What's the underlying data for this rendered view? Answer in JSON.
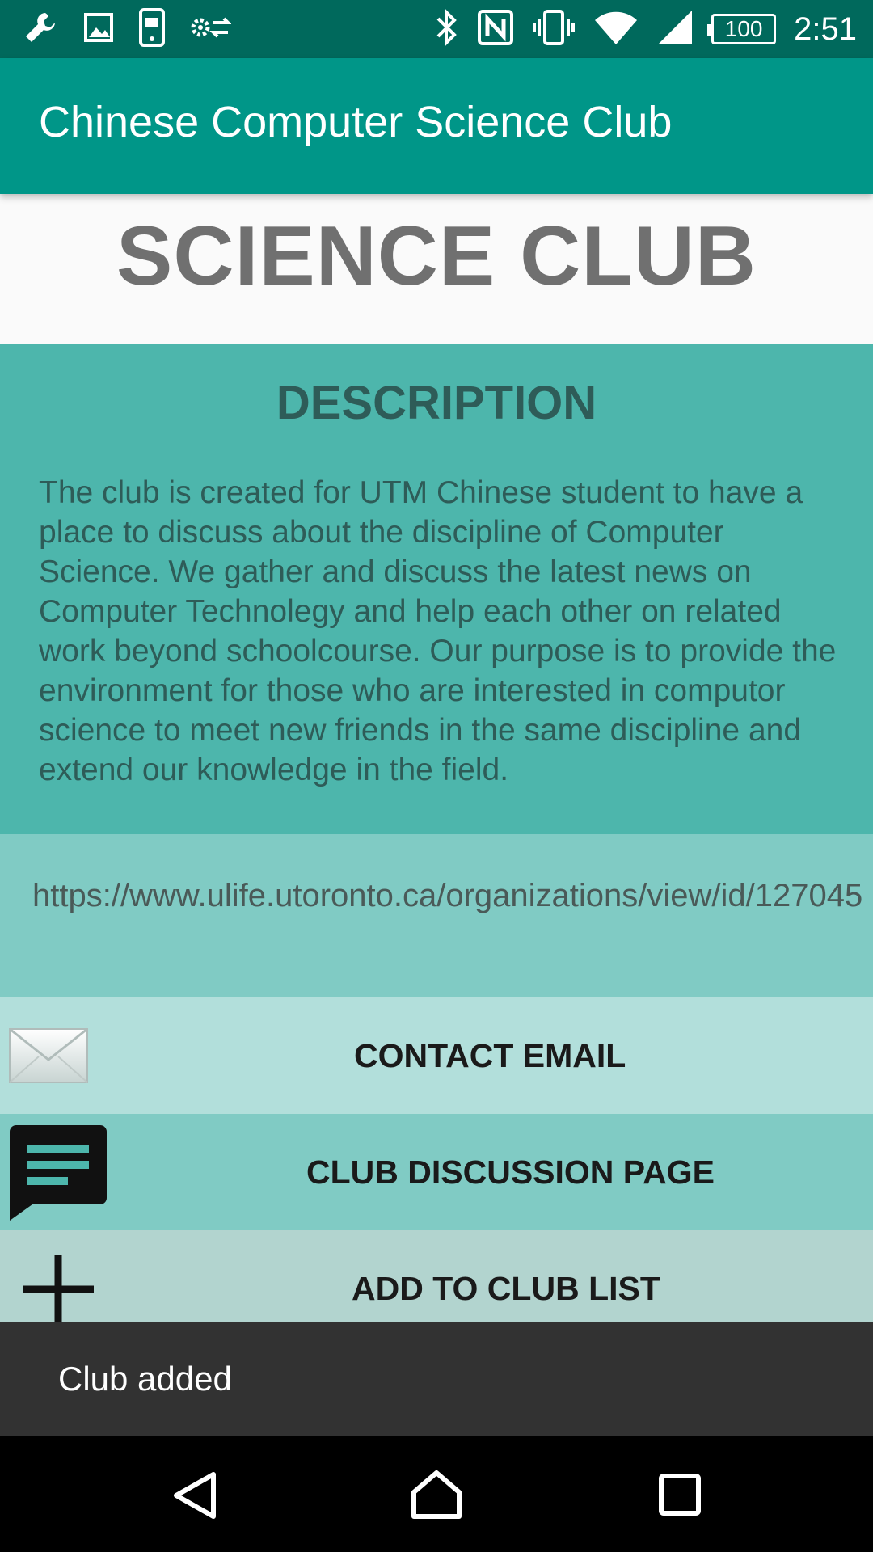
{
  "status_bar": {
    "left_icons": [
      "wrench-icon",
      "image-icon",
      "phone-icon",
      "settings-sync-icon"
    ],
    "right_icons": [
      "bluetooth-icon",
      "nfc-icon",
      "vibrate-icon",
      "wifi-icon",
      "signal-icon"
    ],
    "battery": "100",
    "time": "2:51"
  },
  "app_bar": {
    "title": "Chinese Computer Science Club"
  },
  "header": {
    "club_name": "SCIENCE CLUB"
  },
  "description": {
    "heading": "DESCRIPTION",
    "text": "The club is created for UTM Chinese student to have a place to discuss about the discipline of Computer Science. We gather and discuss the latest news on Computer Technolegy and help each other on related work beyond schoolcourse. Our purpose is to provide the environment for those who are interested in computor science to meet new friends in the same discipline and extend our knowledge in the field."
  },
  "link": {
    "url": "https://www.ulife.utoronto.ca/organizations/view/id/127045"
  },
  "actions": {
    "email_label": "CONTACT EMAIL",
    "discussion_label": "CLUB DISCUSSION PAGE",
    "add_label": "ADD TO CLUB LIST"
  },
  "snackbar": {
    "message": "Club added"
  },
  "nav_bar": {
    "buttons": [
      "back-icon",
      "home-icon",
      "recents-icon"
    ]
  },
  "colors": {
    "status_bar": "#00695c",
    "app_bar": "#009688",
    "description_bg": "#4db6ac",
    "link_bg": "#80cbc4",
    "email_bg": "#b2dfdb",
    "add_bg": "#b2d4cf",
    "snackbar_bg": "#323232"
  }
}
